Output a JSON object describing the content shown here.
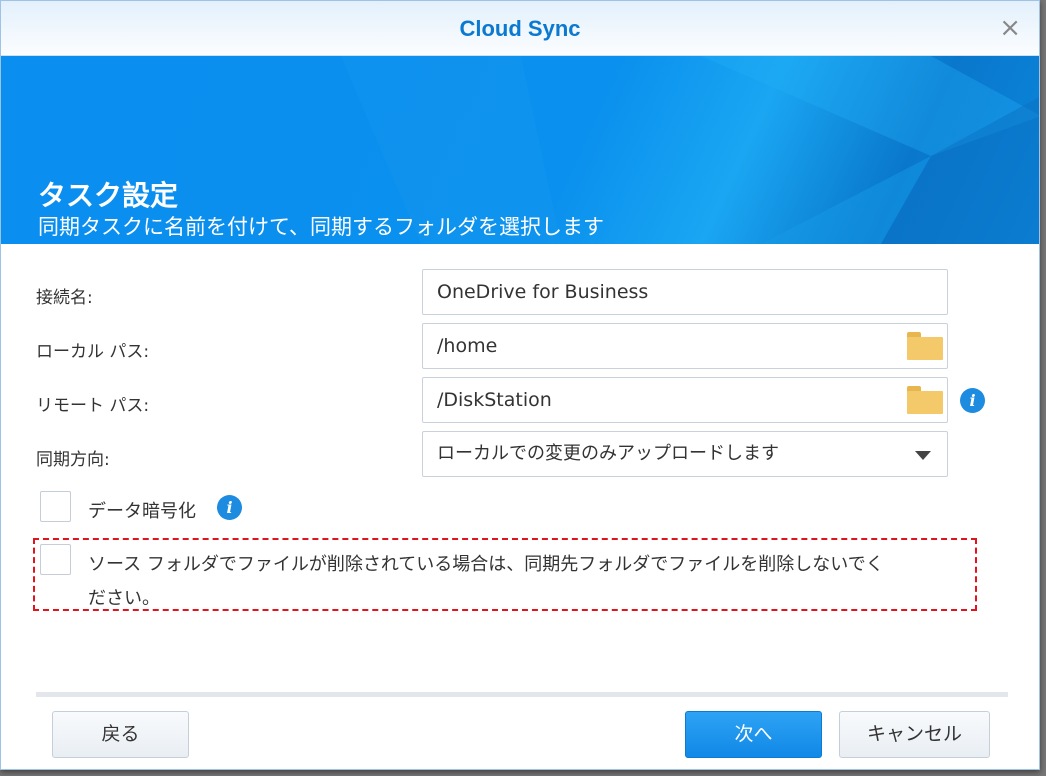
{
  "window": {
    "title": "Cloud Sync",
    "close": "×"
  },
  "banner": {
    "title": "タスク設定",
    "subtitle": "同期タスクに名前を付けて、同期するフォルダを選択します"
  },
  "form": {
    "connection_name": {
      "label": "接続名:",
      "value": "OneDrive for Business"
    },
    "local_path": {
      "label": "ローカル パス:",
      "value": "/home"
    },
    "remote_path": {
      "label": "リモート パス:",
      "value": "/DiskStation"
    },
    "sync_direction": {
      "label": "同期方向:",
      "value": "ローカルでの変更のみアップロードします"
    },
    "encrypt": {
      "label": "データ暗号化",
      "checked": false
    },
    "no_delete": {
      "label_line1": "ソース フォルダでファイルが削除されている場合は、同期先フォルダでファイルを削除しないでく",
      "label_line2": "ださい。",
      "checked": false
    }
  },
  "info_icon": "i",
  "footer": {
    "back": "戻る",
    "next": "次へ",
    "cancel": "キャンセル"
  }
}
